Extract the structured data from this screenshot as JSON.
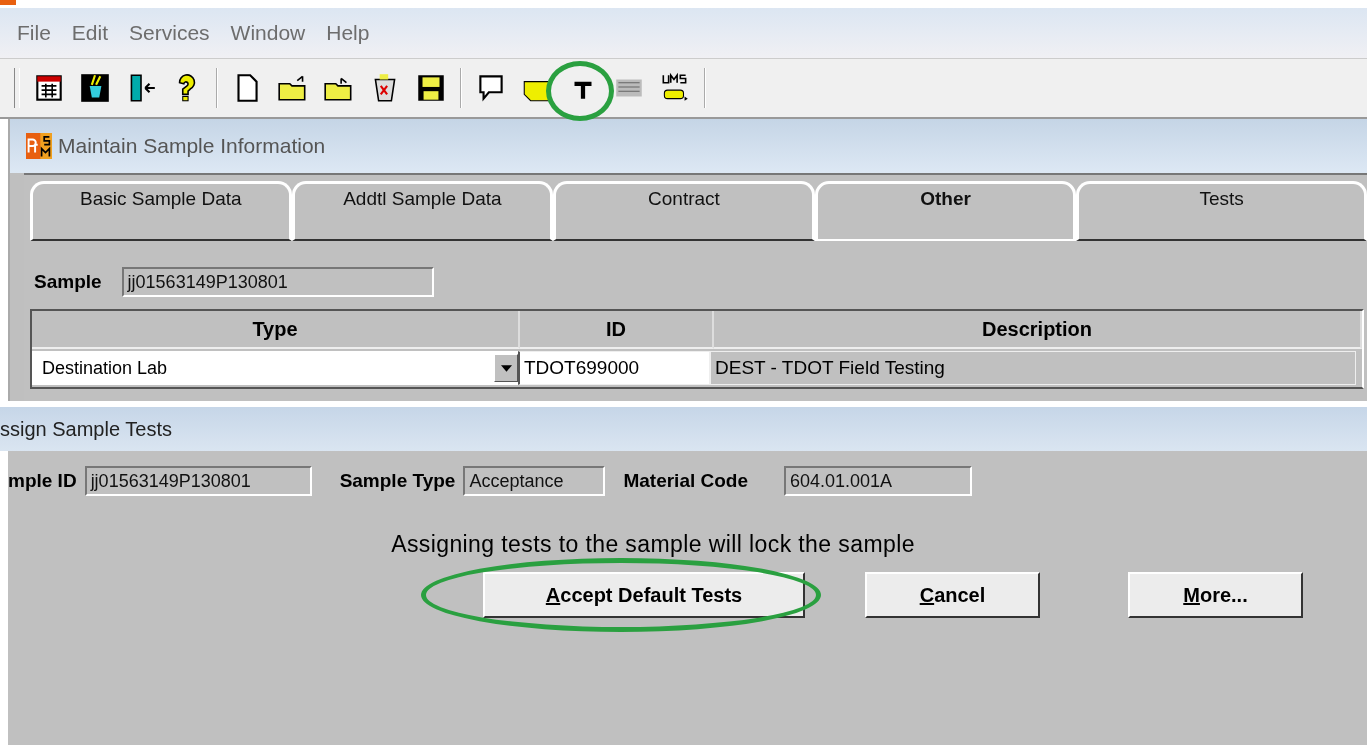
{
  "menu": [
    "File",
    "Edit",
    "Services",
    "Window",
    "Help"
  ],
  "inner_window": {
    "title": "Maintain Sample Information",
    "tabs": [
      {
        "label": "Basic Sample Data",
        "selected": false
      },
      {
        "label": "Addtl Sample Data",
        "selected": false
      },
      {
        "label": "Contract",
        "selected": false
      },
      {
        "label": "Other",
        "selected": true
      },
      {
        "label": "Tests",
        "selected": false
      }
    ],
    "sample_label": "Sample",
    "sample_value": "jj01563149P130801",
    "table": {
      "columns": [
        "Type",
        "ID",
        "Description"
      ],
      "rows": [
        {
          "type": "Destination Lab",
          "id": "TDOT699000",
          "description": "DEST - TDOT Field Testing"
        }
      ]
    }
  },
  "dialog": {
    "title": "ssign Sample Tests",
    "fields": [
      {
        "label": "mple ID",
        "value": "jj01563149P130801"
      },
      {
        "label": "Sample Type",
        "value": "Acceptance"
      },
      {
        "label": "Material Code",
        "value": "604.01.001A"
      }
    ],
    "message": "Assigning tests to the sample will lock the sample",
    "buttons": [
      {
        "label": "Accept Default Tests",
        "highlighted": true
      },
      {
        "label": "Cancel",
        "highlighted": false
      },
      {
        "label": "More...",
        "highlighted": false
      }
    ]
  }
}
